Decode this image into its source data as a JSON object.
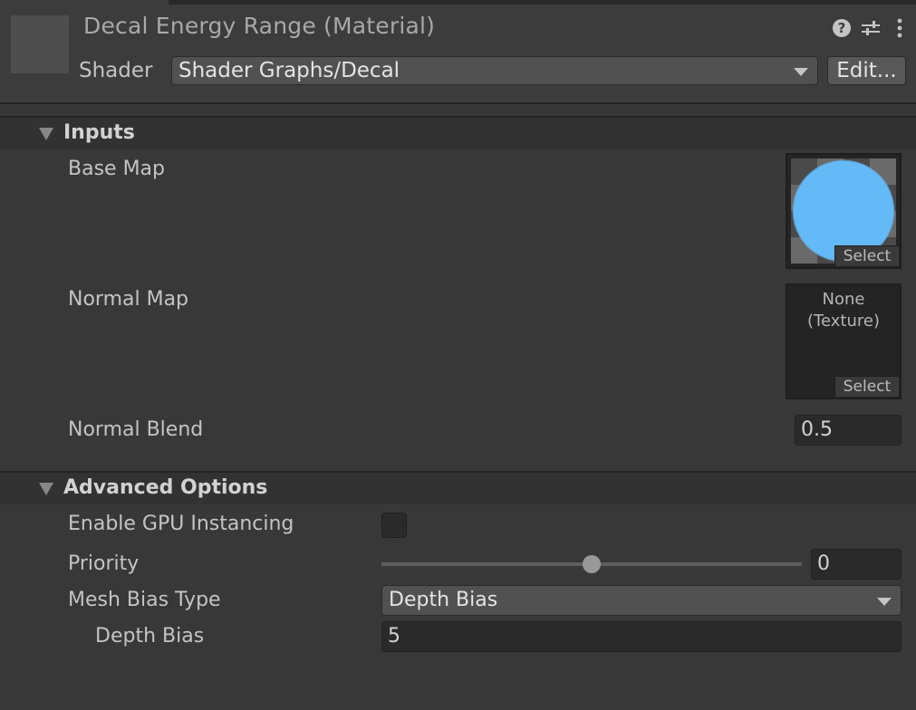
{
  "header": {
    "title": "Decal Energy Range (Material)",
    "icons": [
      "help-icon",
      "presets-icon",
      "more-options-icon"
    ],
    "shader_label": "Shader",
    "shader_value": "Shader Graphs/Decal",
    "edit_button": "Edit..."
  },
  "sections": {
    "inputs": {
      "title": "Inputs",
      "expanded": true,
      "base_map": {
        "label": "Base Map",
        "texture_color": "#64b9f7",
        "select_label": "Select"
      },
      "normal_map": {
        "label": "Normal Map",
        "value_line1": "None",
        "value_line2": "(Texture)",
        "select_label": "Select"
      },
      "normal_blend": {
        "label": "Normal Blend",
        "value": "0.5"
      }
    },
    "advanced": {
      "title": "Advanced Options",
      "expanded": true,
      "gpu_instancing": {
        "label": "Enable GPU Instancing",
        "checked": false
      },
      "priority": {
        "label": "Priority",
        "value": "0",
        "slider_fraction": 0.5
      },
      "mesh_bias_type": {
        "label": "Mesh Bias Type",
        "value": "Depth Bias"
      },
      "depth_bias": {
        "label": "Depth Bias",
        "value": "5"
      }
    }
  },
  "colors": {
    "background": "#383838",
    "header_background": "#3c3c3c",
    "section_header": "#323232",
    "texture_accent": "#64b9f7"
  }
}
